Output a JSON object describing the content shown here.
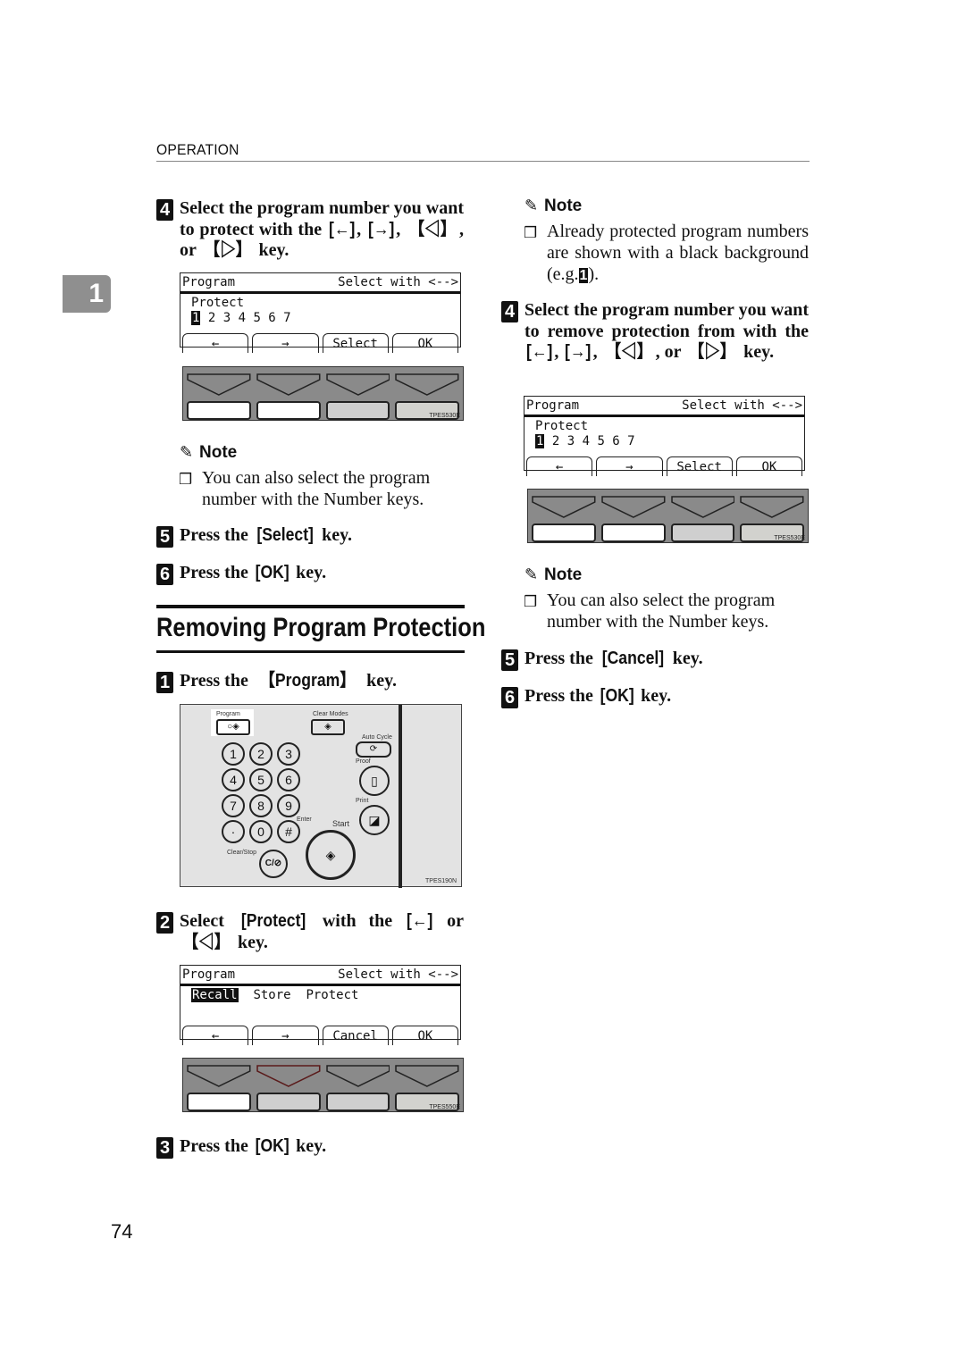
{
  "header": {
    "section_label": "OPERATION",
    "chapter_tab": "1"
  },
  "page_number": "74",
  "left_column": {
    "step4": {
      "number": "4",
      "text_before": "Select the program number you want to protect with the ",
      "keys": [
        "[←]",
        "[→]",
        "【◁】",
        "【▷】"
      ],
      "text_after": " key."
    },
    "lcd1": {
      "title": "Program",
      "hint": "Select with <-->",
      "line1": "Protect",
      "selected_number": "1",
      "numbers": "2 3 4 5 6 7",
      "softkeys": [
        "←",
        "→",
        "Select",
        "OK"
      ]
    },
    "keypanel1": {
      "caption": "TPES530E",
      "key_states": [
        "white",
        "white",
        "gray",
        "gray"
      ]
    },
    "note1": {
      "title": "Note",
      "text": "You can also select the program number with the Number keys."
    },
    "step5": {
      "number": "5",
      "text_before": "Press the ",
      "key": "[Select]",
      "text_after": " key."
    },
    "step6": {
      "number": "6",
      "text_before": "Press the ",
      "key": "[OK]",
      "text_after": " key."
    },
    "section": {
      "title": "Removing Program Protection"
    },
    "r_step1": {
      "number": "1",
      "text_before": "Press the ",
      "key": "【Program】",
      "text_after": " key."
    },
    "control_panel": {
      "caption": "TPES190N",
      "labels": {
        "program": "Program",
        "clear_modes": "Clear Modes",
        "auto_cycle": "Auto Cycle",
        "proof": "Proof",
        "print": "Print",
        "enter": "Enter",
        "start": "Start",
        "clear_stop": "Clear/Stop",
        "clear_stop_key": "C/⊘"
      },
      "number_keys": [
        "1",
        "2",
        "3",
        "4",
        "5",
        "6",
        "7",
        "8",
        "9",
        "·",
        "0",
        "#"
      ]
    },
    "r_step2": {
      "number": "2",
      "text_before": "Select ",
      "key": "[Protect]",
      "text_mid": " with the ",
      "keys": [
        "[←]",
        "【◁】"
      ],
      "text_after": " key."
    },
    "lcd2": {
      "title": "Program",
      "hint": "Select with <-->",
      "options": [
        "Recall",
        "Store",
        "Protect"
      ],
      "highlighted": "Recall",
      "softkeys": [
        "←",
        "→",
        "Cancel",
        "OK"
      ]
    },
    "keypanel2": {
      "caption": "TPES550E",
      "key_states": [
        "white",
        "gray",
        "gray",
        "gray"
      ]
    },
    "r_step3": {
      "number": "3",
      "text_before": "Press the ",
      "key": "[OK]",
      "text_after": " key."
    }
  },
  "right_column": {
    "note_top": {
      "title": "Note",
      "text": "Already protected program numbers are shown with a black background (e.g.",
      "example": "1",
      "text_end": ")."
    },
    "r_step4": {
      "number": "4",
      "text_before": "Select the program number you want to remove protection from with the ",
      "keys": [
        "[←]",
        "[→]",
        "【◁】",
        "【▷】"
      ],
      "text_after": " key."
    },
    "lcd3": {
      "title": "Program",
      "hint": "Select with <-->",
      "line1": "Protect",
      "selected_number": "1",
      "numbers": "2 3 4 5 6 7",
      "softkeys": [
        "←",
        "→",
        "Select",
        "OK"
      ]
    },
    "keypanel3": {
      "caption": "TPES530E",
      "key_states": [
        "white",
        "white",
        "gray",
        "gray"
      ]
    },
    "note2": {
      "title": "Note",
      "text": "You can also select the program number with the Number keys."
    },
    "r_step5": {
      "number": "5",
      "text_before": "Press the ",
      "key": "[Cancel]",
      "text_after": " key."
    },
    "r_step6": {
      "number": "6",
      "text_before": "Press the ",
      "key": "[OK]",
      "text_after": " key."
    }
  }
}
